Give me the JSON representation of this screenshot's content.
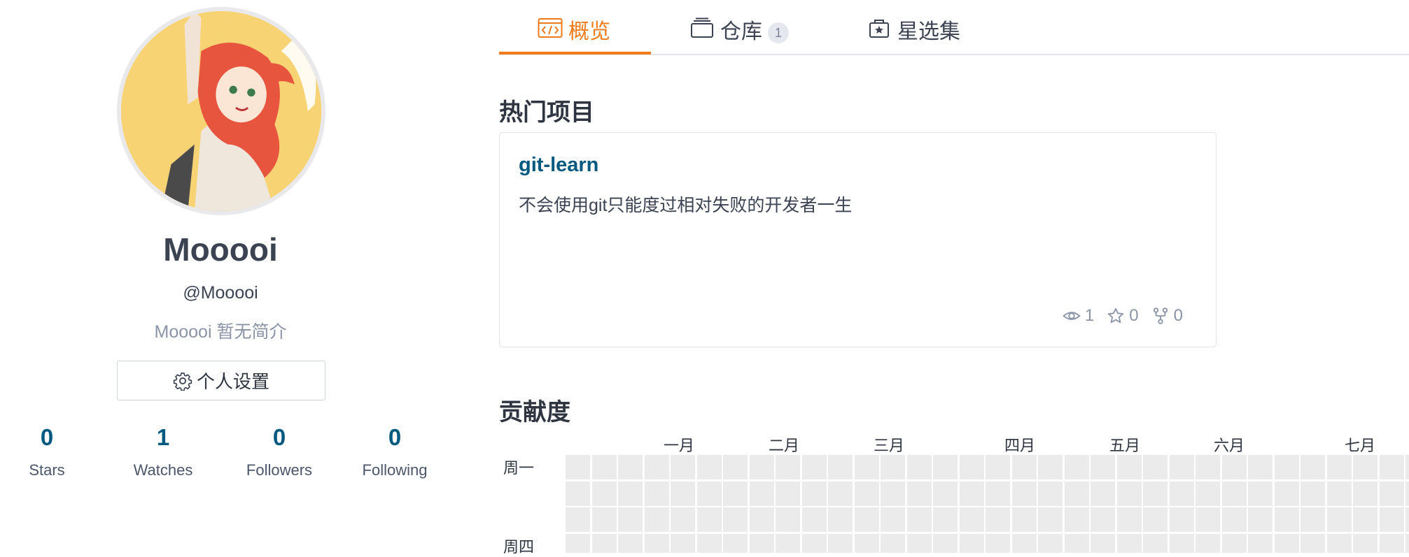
{
  "profile": {
    "display_name": "Mooooi",
    "handle": "@Mooooi",
    "bio": "Mooooi 暂无简介",
    "settings_label": "个人设置",
    "stats": [
      {
        "value": "0",
        "label": "Stars"
      },
      {
        "value": "1",
        "label": "Watches"
      },
      {
        "value": "0",
        "label": "Followers"
      },
      {
        "value": "0",
        "label": "Following"
      }
    ]
  },
  "tabs": [
    {
      "label": "概览",
      "icon": "code-window-icon",
      "active": true
    },
    {
      "label": "仓库",
      "icon": "repo-stack-icon",
      "count": "1"
    },
    {
      "label": "星选集",
      "icon": "star-box-icon"
    }
  ],
  "popular": {
    "title": "热门项目",
    "project": {
      "name": "git-learn",
      "description": "不会使用git只能度过相对失败的开发者一生",
      "watches": "1",
      "stars": "0",
      "forks": "0"
    }
  },
  "contribution": {
    "title": "贡献度",
    "months": [
      "一月",
      "二月",
      "三月",
      "四月",
      "五月",
      "六月",
      "七月"
    ],
    "weekdays": [
      "周一",
      "周四"
    ]
  },
  "colors": {
    "accent": "#f07b1c",
    "link": "#005980",
    "empty_cell": "#ebebeb"
  }
}
